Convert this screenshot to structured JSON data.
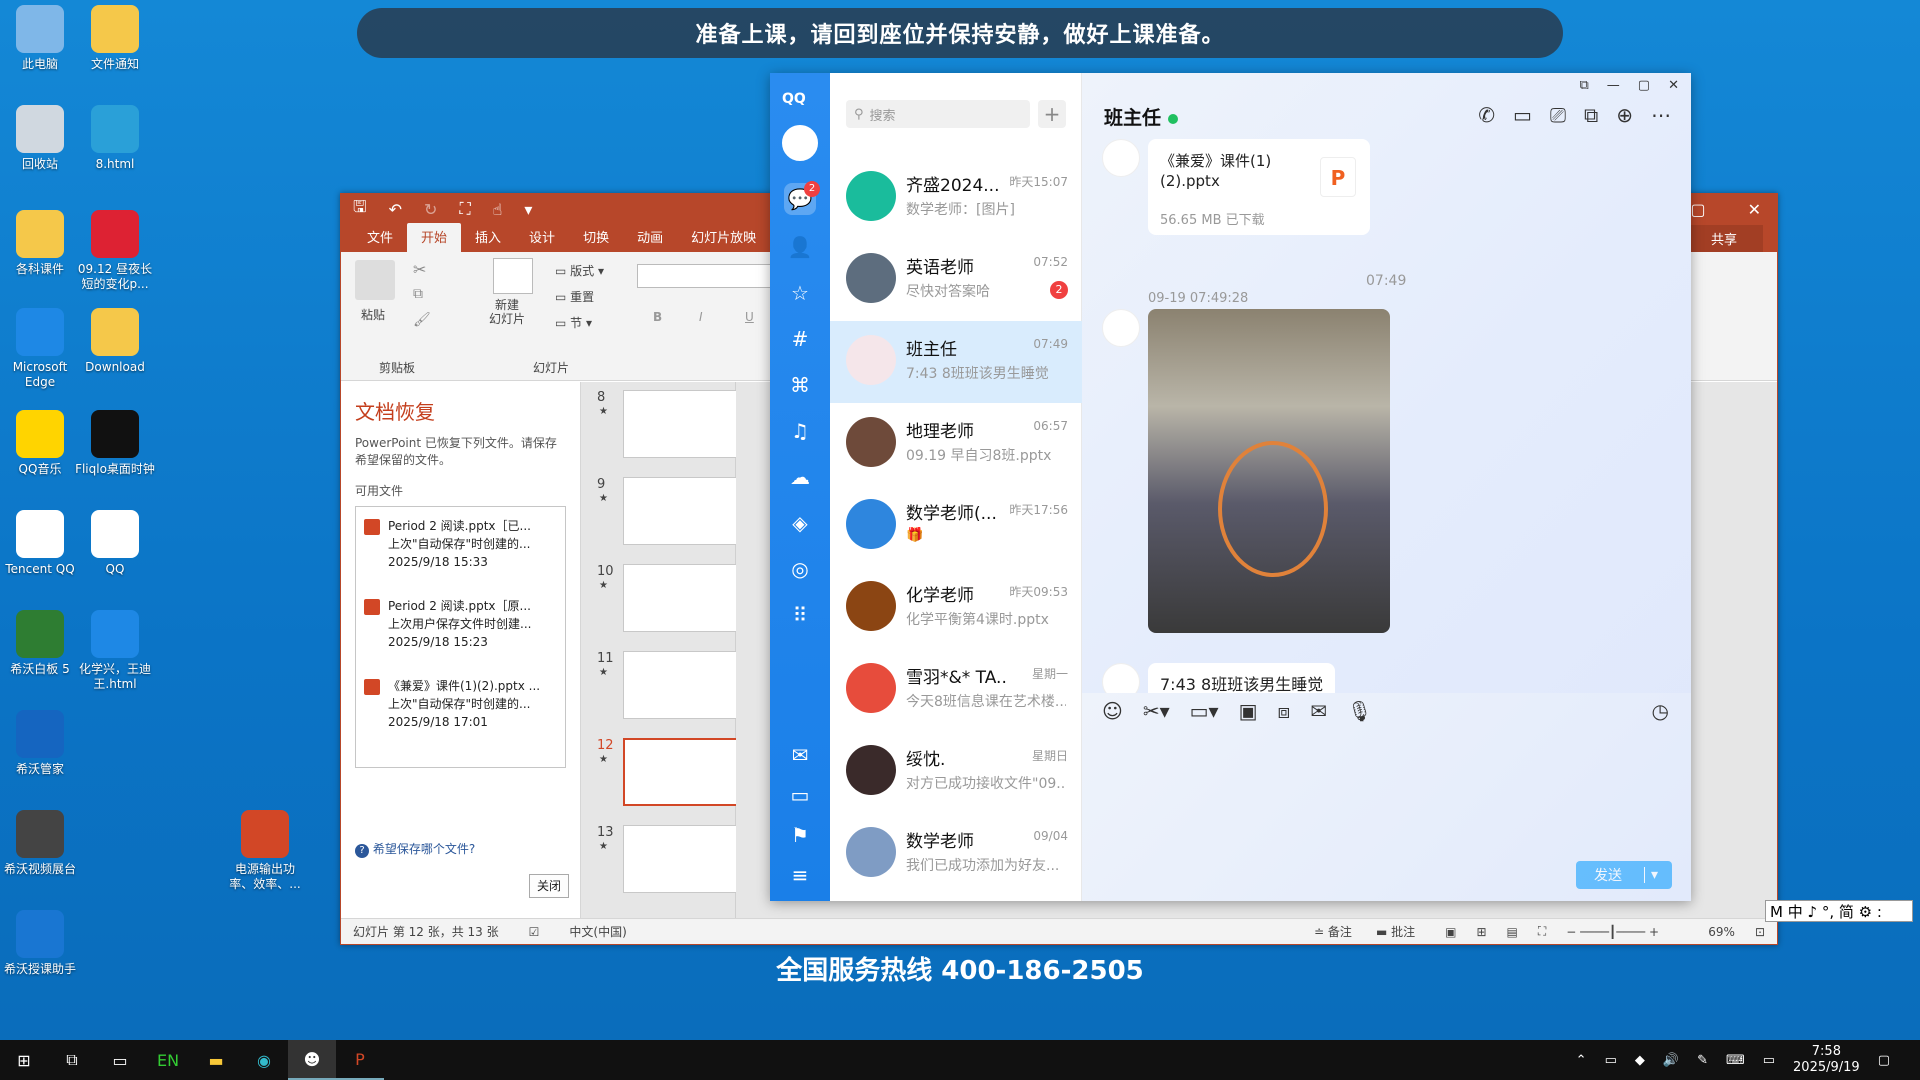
{
  "banner": "准备上课，请回到座位并保持安静，做好上课准备。",
  "hotline": "全国服务热线 400-186-2505",
  "desktop_icons": [
    {
      "label": "此电脑"
    },
    {
      "label": "文件通知"
    },
    {
      "label": "回收站"
    },
    {
      "label": "8.html"
    },
    {
      "label": "各科课件"
    },
    {
      "label": "09.12 昼夜长短的变化p..."
    },
    {
      "label": "Microsoft Edge"
    },
    {
      "label": "Download"
    },
    {
      "label": "QQ音乐"
    },
    {
      "label": "Fliqlo桌面时钟"
    },
    {
      "label": "Tencent QQ"
    },
    {
      "label": "QQ"
    },
    {
      "label": "希沃白板 5"
    },
    {
      "label": "化学兴，王迪王.html"
    },
    {
      "label": "希沃管家"
    },
    {
      "label": "希沃视频展台"
    },
    {
      "label": "电源输出功率、效率、..."
    },
    {
      "label": "希沃授课助手"
    }
  ],
  "ppt": {
    "tabs": [
      "文件",
      "开始",
      "插入",
      "设计",
      "切换",
      "动画",
      "幻灯片放映"
    ],
    "share": "共享",
    "ribbon": {
      "paste": "粘贴",
      "clipboard": "剪贴板",
      "new_slide": "新建\n幻灯片",
      "layout": "版式",
      "reset": "重置",
      "section": "节",
      "slides": "幻灯片"
    },
    "recovery": {
      "title": "文档恢复",
      "desc": "PowerPoint 已恢复下列文件。请保存希望保留的文件。",
      "available": "可用文件",
      "files": [
        {
          "name": "Period 2 阅读.pptx［已...",
          "note": "上次\"自动保存\"时创建的...",
          "time": "2025/9/18 15:33"
        },
        {
          "name": "Period 2 阅读.pptx［原...",
          "note": "上次用户保存文件时创建...",
          "time": "2025/9/18 15:23"
        },
        {
          "name": "《兼爱》课件(1)(2).pptx ...",
          "note": "上次\"自动保存\"时创建的...",
          "time": "2025/9/18 17:01"
        }
      ],
      "help": "希望保存哪个文件?",
      "close": "关闭"
    },
    "slides": [
      "8",
      "9",
      "10",
      "11",
      "12",
      "13"
    ],
    "selected_slide": "12",
    "status": {
      "slide_info": "幻灯片 第 12 张，共 13 张",
      "lang": "中文(中国)",
      "notes": "备注",
      "comments": "批注",
      "zoom": "69%"
    }
  },
  "qq": {
    "logo": "QQ",
    "nav_badge": "2",
    "search_placeholder": "搜索",
    "chats": [
      {
        "name": "齐盛2024...",
        "time": "昨天15:07",
        "preview": "数学老师：[图片]",
        "color": "#1abc9c"
      },
      {
        "name": "英语老师",
        "time": "07:52",
        "preview": "尽快对答案哈",
        "badge": "2",
        "color": "#5d6d7e"
      },
      {
        "name": "班主任",
        "time": "07:49",
        "preview": "7:43 8班班该男生睡觉",
        "color": "#f5e6ea",
        "selected": true
      },
      {
        "name": "地理老师",
        "time": "06:57",
        "preview": "09.19 早自习8班.pptx",
        "color": "#6e4a3a"
      },
      {
        "name": "数学老师(...",
        "time": "昨天17:56",
        "preview": "🎁",
        "color": "#2e86de"
      },
      {
        "name": "化学老师",
        "time": "昨天09:53",
        "preview": "化学平衡第4课时.pptx",
        "color": "#8b4513"
      },
      {
        "name": "雪羽*&* TA...",
        "time": "星期一",
        "preview": "今天8班信息课在艺术楼...",
        "color": "#e74c3c"
      },
      {
        "name": "绥忱.",
        "time": "星期日",
        "preview": "对方已成功接收文件\"09...",
        "color": "#3a2a2a"
      },
      {
        "name": "数学老师",
        "time": "09/04",
        "preview": "我们已成功添加为好友...",
        "color": "#7f9cc4"
      }
    ],
    "chat": {
      "title": "班主任",
      "file_name": "《兼爱》课件(1)(2).pptx",
      "file_size": "56.65 MB",
      "file_status": "已下载",
      "time_sep": "07:49",
      "img_time": "09-19 07:49:28",
      "last_msg": "7:43  8班班该男生睡觉",
      "send": "发送"
    }
  },
  "ime": "M 中 ♪ °, 简 ⚙ :",
  "taskbar": {
    "time": "7:58",
    "date": "2025/9/19"
  }
}
